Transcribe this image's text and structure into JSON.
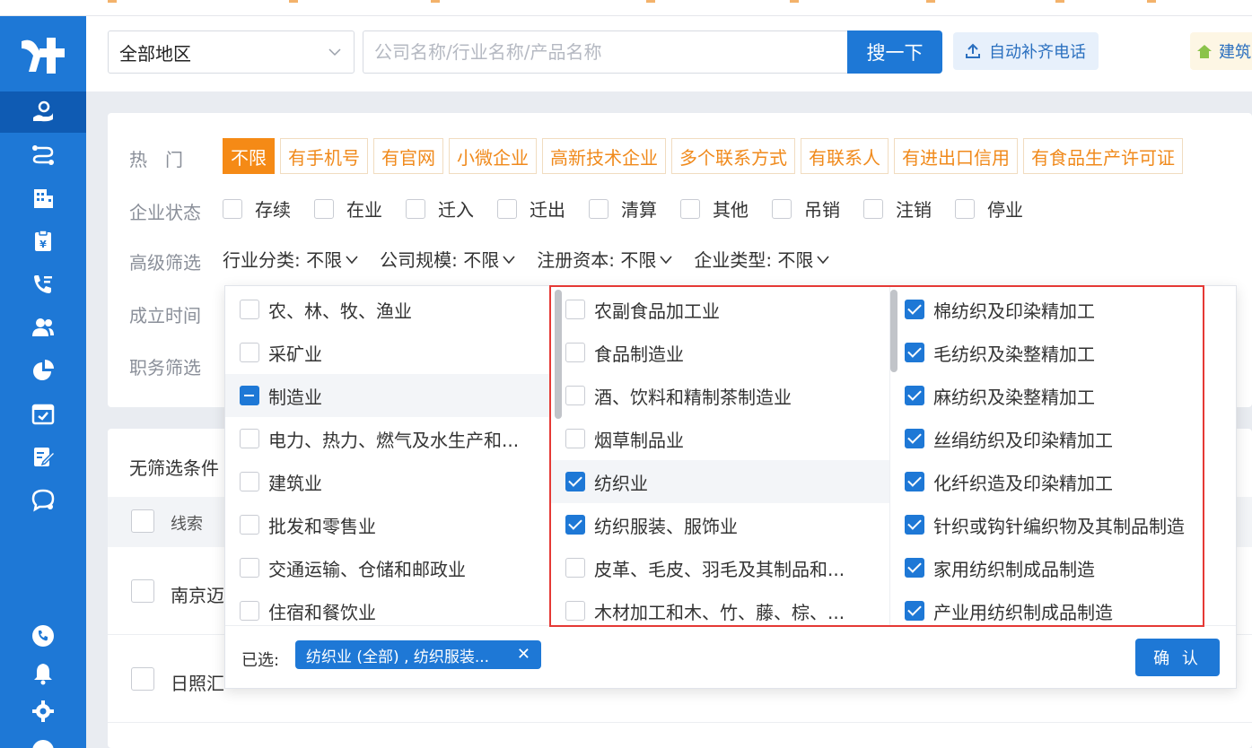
{
  "header": {
    "region": "全部地区",
    "search_placeholder": "公司名称/行业名称/产品名称",
    "search_button": "搜一下",
    "auto_phone_button": "自动补齐电话",
    "build_button": "建筑"
  },
  "filters": {
    "hot_label": "热　门",
    "hot_tags": [
      "不限",
      "有手机号",
      "有官网",
      "小微企业",
      "高新技术企业",
      "多个联系方式",
      "有联系人",
      "有进出口信用",
      "有食品生产许可证"
    ],
    "status_label": "企业状态",
    "status_options": [
      "存续",
      "在业",
      "迁入",
      "迁出",
      "清算",
      "其他",
      "吊销",
      "注销",
      "停业"
    ],
    "advanced_label": "高级筛选",
    "advanced_items": [
      "行业分类: 不限",
      "公司规模: 不限",
      "注册资本: 不限",
      "企业类型: 不限"
    ],
    "founded_label": "成立时间",
    "position_label": "职务筛选"
  },
  "list": {
    "no_filter": "无筛选条件",
    "column_label": "线索",
    "rows": [
      "南京迈",
      "日照汇"
    ]
  },
  "cascader": {
    "level1": [
      {
        "label": "农、林、牧、渔业",
        "state": "unchecked"
      },
      {
        "label": "采矿业",
        "state": "unchecked"
      },
      {
        "label": "制造业",
        "state": "indeterminate"
      },
      {
        "label": "电力、热力、燃气及水生产和...",
        "state": "unchecked"
      },
      {
        "label": "建筑业",
        "state": "unchecked"
      },
      {
        "label": "批发和零售业",
        "state": "unchecked"
      },
      {
        "label": "交通运输、仓储和邮政业",
        "state": "unchecked"
      },
      {
        "label": "住宿和餐饮业",
        "state": "unchecked"
      }
    ],
    "level2": [
      {
        "label": "农副食品加工业",
        "state": "unchecked"
      },
      {
        "label": "食品制造业",
        "state": "unchecked"
      },
      {
        "label": "酒、饮料和精制茶制造业",
        "state": "unchecked"
      },
      {
        "label": "烟草制品业",
        "state": "unchecked"
      },
      {
        "label": "纺织业",
        "state": "checked"
      },
      {
        "label": "纺织服装、服饰业",
        "state": "checked"
      },
      {
        "label": "皮革、毛皮、羽毛及其制品和...",
        "state": "unchecked"
      },
      {
        "label": "木材加工和木、竹、藤、棕、...",
        "state": "unchecked"
      }
    ],
    "level3": [
      {
        "label": "棉纺织及印染精加工",
        "state": "checked"
      },
      {
        "label": "毛纺织及染整精加工",
        "state": "checked"
      },
      {
        "label": "麻纺织及染整精加工",
        "state": "checked"
      },
      {
        "label": "丝绢纺织及印染精加工",
        "state": "checked"
      },
      {
        "label": "化纤织造及印染精加工",
        "state": "checked"
      },
      {
        "label": "针织或钩针编织物及其制品制造",
        "state": "checked"
      },
      {
        "label": "家用纺织制成品制造",
        "state": "checked"
      },
      {
        "label": "产业用纺织制成品制造",
        "state": "checked"
      }
    ],
    "selected_label": "已选:",
    "selected_chip": "纺织业 (全部) , 纺织服装...",
    "confirm": "确 认"
  },
  "colors": {
    "primary": "#1e78d6",
    "accent_orange": "#f58a16",
    "highlight_red": "#e53935"
  }
}
